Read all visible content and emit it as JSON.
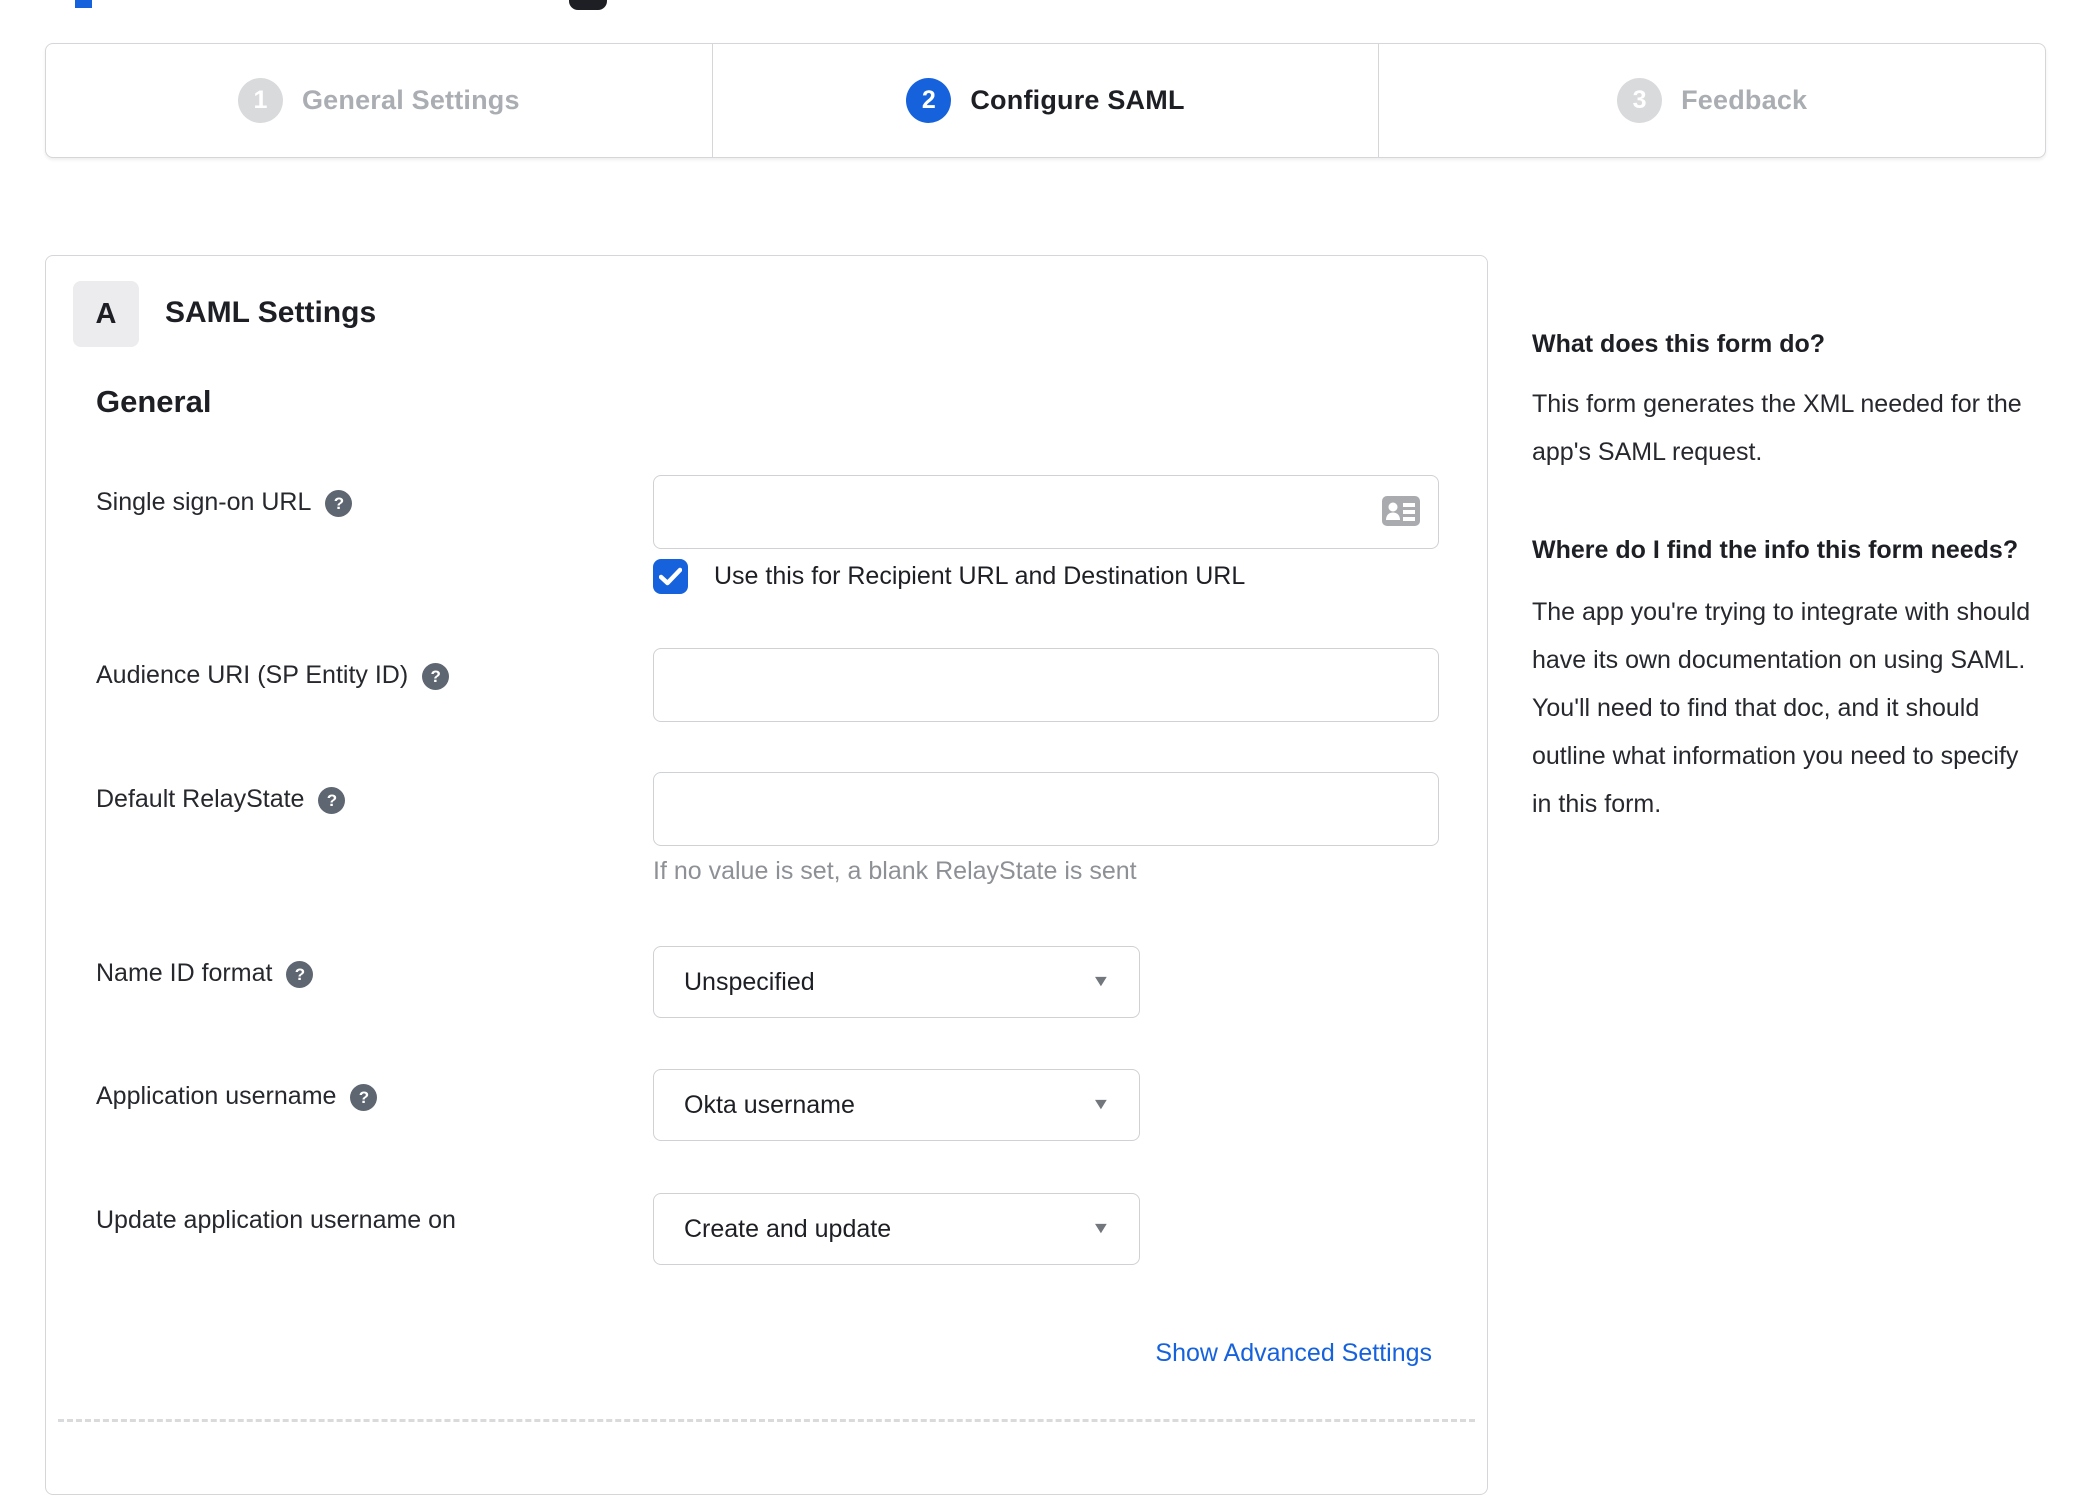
{
  "colors": {
    "accent_blue": "#1662dd",
    "dark_text": "#1d1f24",
    "inactive_step_text": "#aaadb2",
    "inactive_step_circle": "#d9dadc",
    "help_icon_bg": "#5e6672",
    "border_gray": "#d5d6d9",
    "hint_gray": "#8d9095",
    "badge_bg": "#ececee"
  },
  "stepper": {
    "steps": [
      {
        "number": "1",
        "label": "General Settings"
      },
      {
        "number": "2",
        "label": "Configure SAML"
      },
      {
        "number": "3",
        "label": "Feedback"
      }
    ]
  },
  "panel": {
    "badge": "A",
    "title": "SAML Settings",
    "section": "General",
    "advanced_link": "Show Advanced Settings"
  },
  "form": {
    "sso": {
      "label": "Single sign-on URL",
      "value": "",
      "checkbox_label": "Use this for Recipient URL and Destination URL",
      "checkbox_checked": true
    },
    "audience": {
      "label": "Audience URI (SP Entity ID)",
      "value": ""
    },
    "relay": {
      "label": "Default RelayState",
      "value": "",
      "hint": "If no value is set, a blank RelayState is sent"
    },
    "nameid": {
      "label": "Name ID format",
      "value": "Unspecified"
    },
    "appuser": {
      "label": "Application username",
      "value": "Okta username"
    },
    "updateuser": {
      "label": "Update application username on",
      "value": "Create and update"
    }
  },
  "sidebar": {
    "heading1": "What does this form do?",
    "para1": "This form generates the XML needed for the app's SAML request.",
    "heading2": "Where do I find the info this form needs?",
    "para2": "The app you're trying to integrate with should have its own documentation on using SAML. You'll need to find that doc, and it should outline what information you need to specify in this form."
  }
}
